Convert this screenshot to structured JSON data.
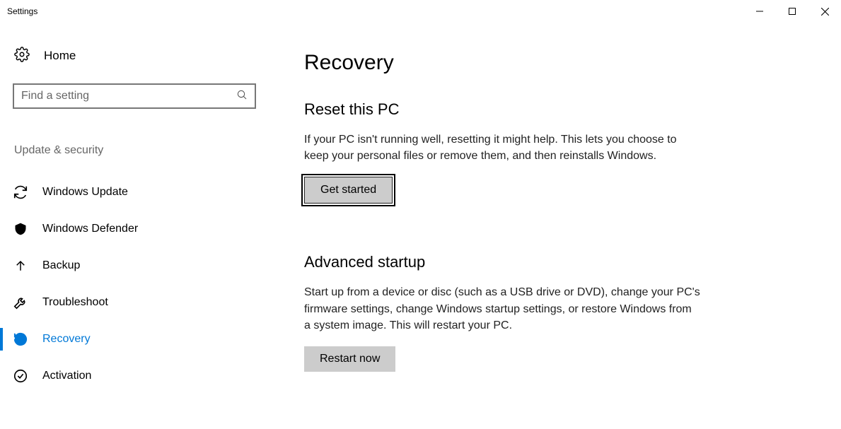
{
  "window": {
    "title": "Settings"
  },
  "sidebar": {
    "home": "Home",
    "search_placeholder": "Find a setting",
    "category": "Update & security",
    "items": [
      {
        "label": "Windows Update"
      },
      {
        "label": "Windows Defender"
      },
      {
        "label": "Backup"
      },
      {
        "label": "Troubleshoot"
      },
      {
        "label": "Recovery"
      },
      {
        "label": "Activation"
      }
    ]
  },
  "main": {
    "title": "Recovery",
    "reset": {
      "heading": "Reset this PC",
      "body": "If your PC isn't running well, resetting it might help. This lets you choose to keep your personal files or remove them, and then reinstalls Windows.",
      "button": "Get started"
    },
    "advanced": {
      "heading": "Advanced startup",
      "body": "Start up from a device or disc (such as a USB drive or DVD), change your PC's firmware settings, change Windows startup settings, or restore Windows from a system image. This will restart your PC.",
      "button": "Restart now"
    }
  }
}
